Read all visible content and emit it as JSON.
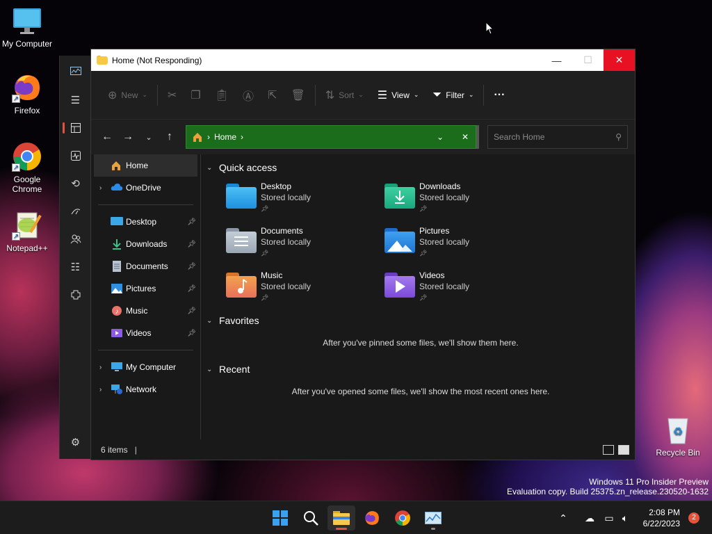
{
  "desktop": {
    "icons": [
      {
        "label": "My Computer"
      },
      {
        "label": "Firefox"
      },
      {
        "label": "Google Chrome"
      },
      {
        "label": "Notepad++"
      },
      {
        "label": "Recycle Bin"
      }
    ]
  },
  "window": {
    "title": "Home (Not Responding)",
    "controls": {
      "minimize": "—",
      "maximize": "☐",
      "close": "✕"
    }
  },
  "toolbar": {
    "new_label": "New",
    "sort_label": "Sort",
    "view_label": "View",
    "filter_label": "Filter",
    "more_label": "···"
  },
  "address": {
    "path": "Home",
    "search_placeholder": "Search Home",
    "color": "#1b6d1b"
  },
  "navpane": {
    "top": [
      {
        "label": "Home"
      },
      {
        "label": "OneDrive"
      }
    ],
    "pinned": [
      {
        "label": "Desktop"
      },
      {
        "label": "Downloads"
      },
      {
        "label": "Documents"
      },
      {
        "label": "Pictures"
      },
      {
        "label": "Music"
      },
      {
        "label": "Videos"
      }
    ],
    "bottom": [
      {
        "label": "My Computer"
      },
      {
        "label": "Network"
      }
    ]
  },
  "content": {
    "quick_access_title": "Quick access",
    "favorites_title": "Favorites",
    "recent_title": "Recent",
    "favorites_empty": "After you've pinned some files, we'll show them here.",
    "recent_empty": "After you've opened some files, we'll show the most recent ones here.",
    "quick_access": [
      {
        "name": "Desktop",
        "status": "Stored locally"
      },
      {
        "name": "Downloads",
        "status": "Stored locally"
      },
      {
        "name": "Documents",
        "status": "Stored locally"
      },
      {
        "name": "Pictures",
        "status": "Stored locally"
      },
      {
        "name": "Music",
        "status": "Stored locally"
      },
      {
        "name": "Videos",
        "status": "Stored locally"
      }
    ]
  },
  "statusbar": {
    "items": "6 items"
  },
  "watermark": {
    "line1": "Windows 11 Pro Insider Preview",
    "line2": "Evaluation copy. Build 25375.zn_release.230520-1632"
  },
  "taskbar": {
    "time": "2:08 PM",
    "date": "6/22/2023",
    "notifications": "2"
  },
  "colors": {
    "accent": "#e5533c",
    "close_button": "#e81123",
    "address_bar": "#1b6d1b"
  }
}
